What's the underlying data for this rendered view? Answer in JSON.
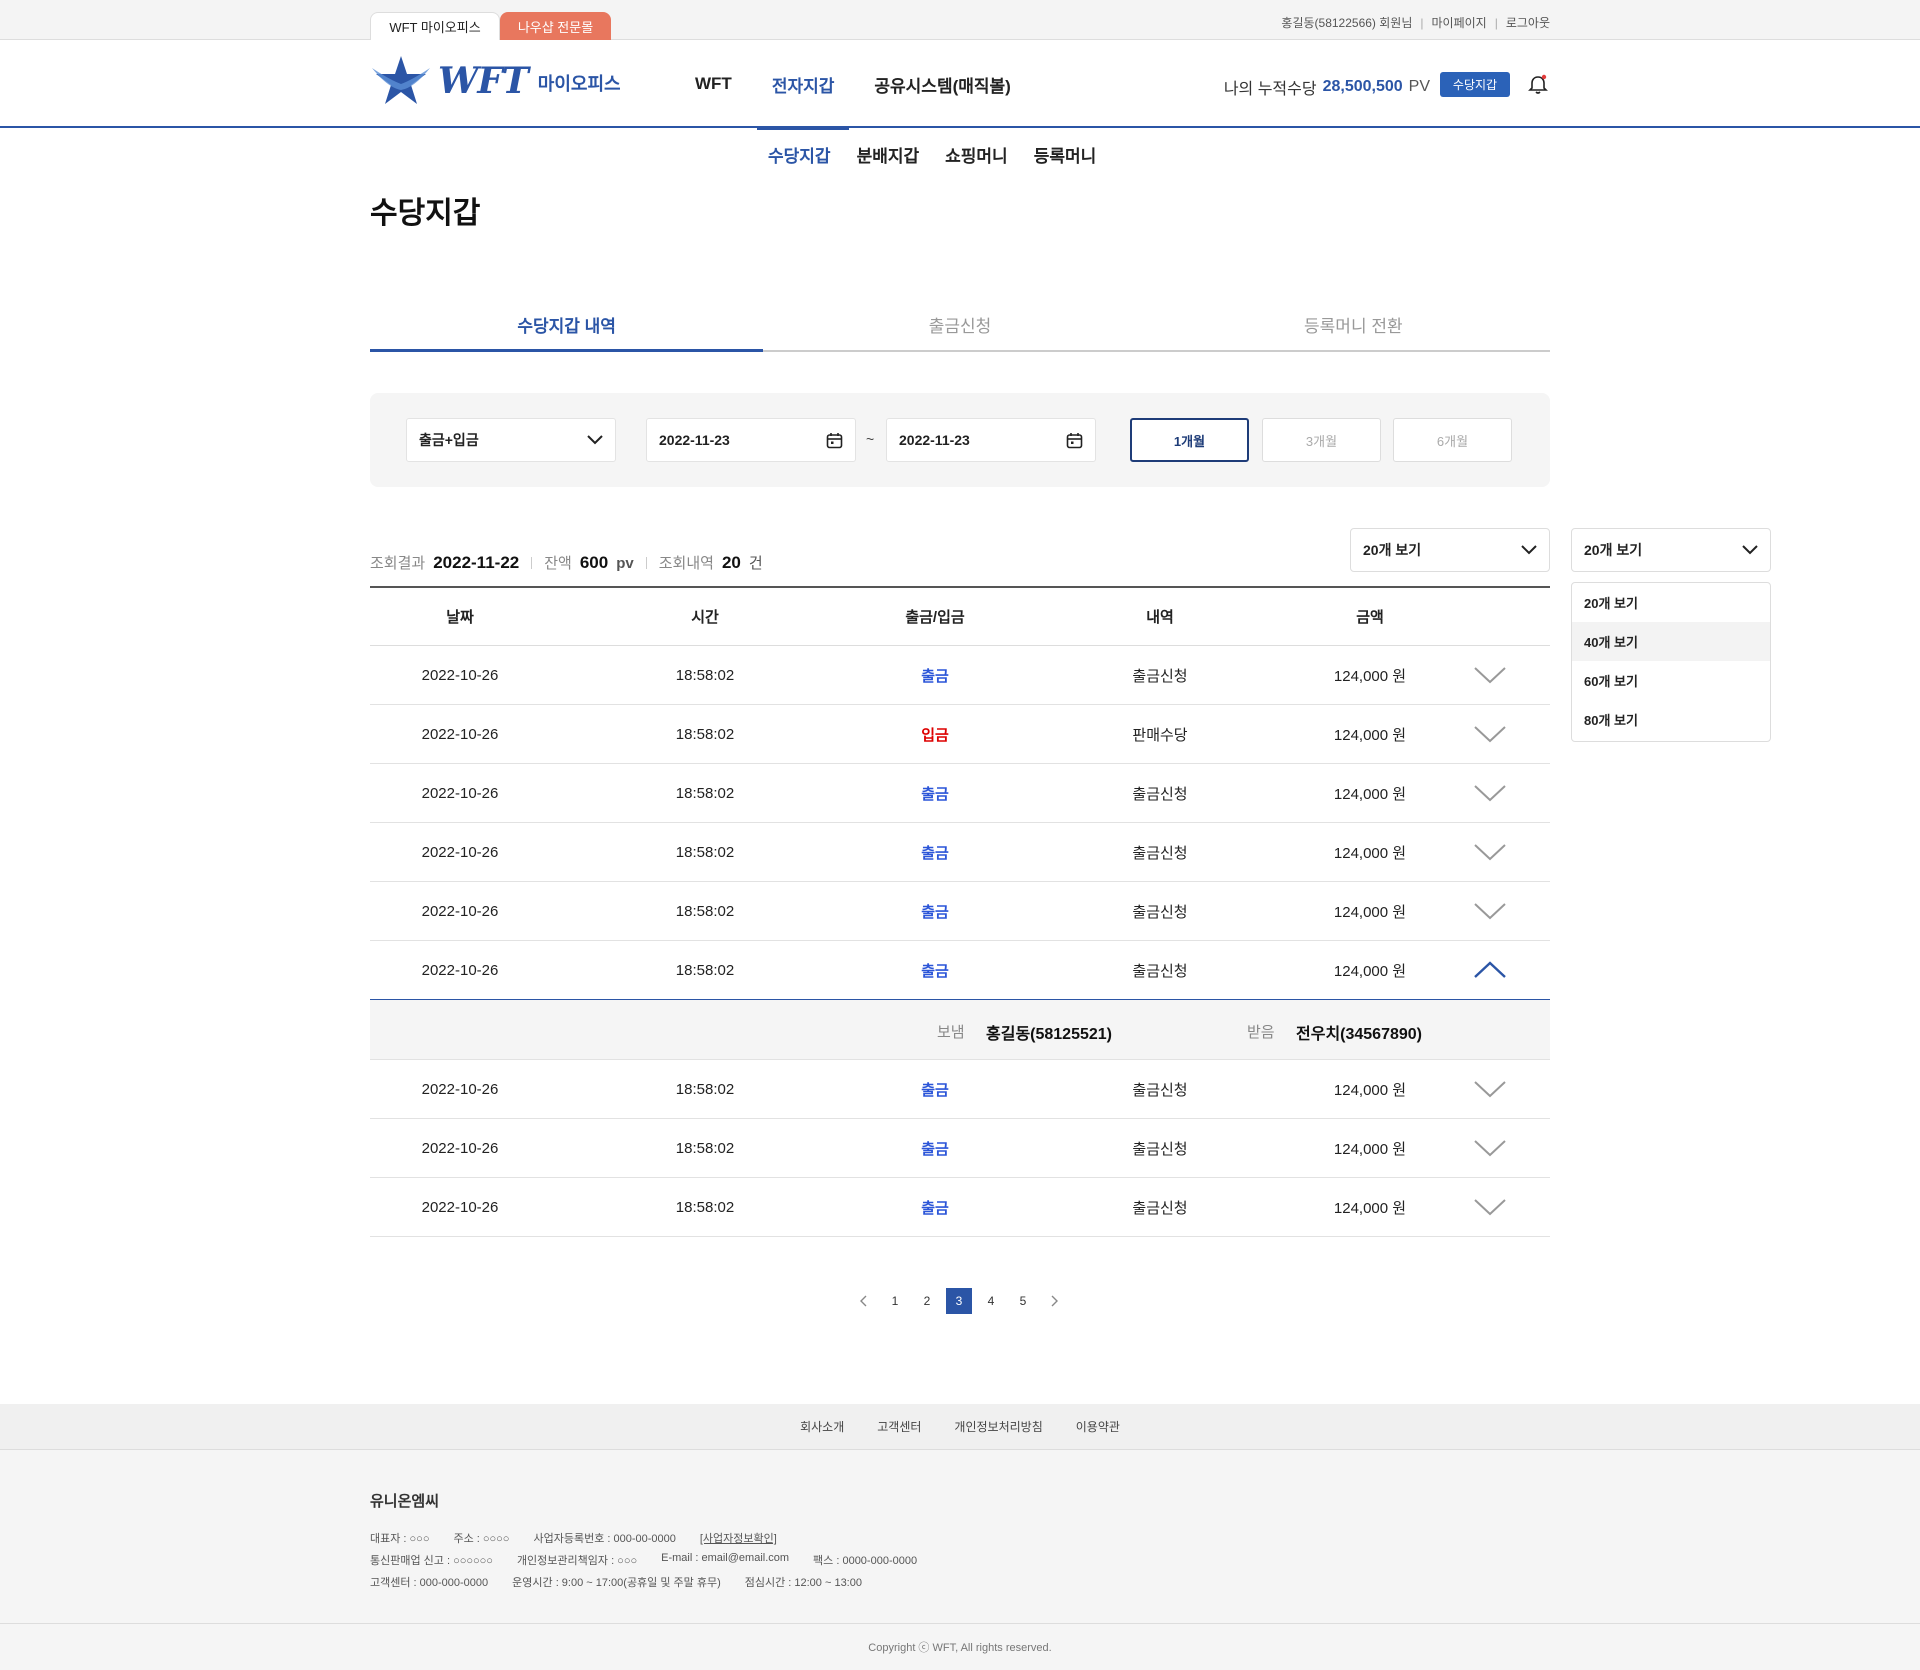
{
  "topbar": {
    "site_tabs": [
      "WFT 마이오피스",
      "나우샵 전문몰"
    ],
    "user": "홍길동(58122566) 회원님",
    "mypage": "마이페이지",
    "logout": "로그아웃"
  },
  "header": {
    "logo_text": "WFT",
    "logo_sub": "마이오피스",
    "gnb": [
      "WFT",
      "전자지갑",
      "공유시스템(매직볼)"
    ],
    "accum_label": "나의 누적수당",
    "accum_value": "28,500,500",
    "accum_unit": "PV",
    "wallet_button": "수당지갑"
  },
  "subnav": [
    "수당지갑",
    "분배지갑",
    "쇼핑머니",
    "등록머니"
  ],
  "page_title": "수당지갑",
  "tabs": [
    "수당지갑 내역",
    "출금신청",
    "등록머니 전환"
  ],
  "filter": {
    "type": "출금+입금",
    "date_from": "2022-11-23",
    "tilde": "~",
    "date_to": "2022-11-23",
    "periods": [
      "1개월",
      "3개월",
      "6개월"
    ]
  },
  "summary": {
    "result_label": "조회결과",
    "result_date": "2022-11-22",
    "balance_label": "잔액",
    "balance_value": "600",
    "balance_unit": "pv",
    "count_label": "조회내역",
    "count_value": "20",
    "count_unit": "건"
  },
  "view_select": {
    "value": "20개 보기",
    "options": [
      "20개 보기",
      "40개 보기",
      "60개 보기",
      "80개 보기"
    ]
  },
  "table": {
    "headers": [
      "날짜",
      "시간",
      "출금/입금",
      "내역",
      "금액"
    ],
    "rows": [
      [
        "2022-10-26",
        "18:58:02",
        "출금",
        "출금신청",
        "124,000 원"
      ],
      [
        "2022-10-26",
        "18:58:02",
        "입금",
        "판매수당",
        "124,000 원"
      ],
      [
        "2022-10-26",
        "18:58:02",
        "출금",
        "출금신청",
        "124,000 원"
      ],
      [
        "2022-10-26",
        "18:58:02",
        "출금",
        "출금신청",
        "124,000 원"
      ],
      [
        "2022-10-26",
        "18:58:02",
        "출금",
        "출금신청",
        "124,000 원"
      ],
      [
        "2022-10-26",
        "18:58:02",
        "출금",
        "출금신청",
        "124,000 원"
      ],
      [
        "2022-10-26",
        "18:58:02",
        "출금",
        "출금신청",
        "124,000 원"
      ],
      [
        "2022-10-26",
        "18:58:02",
        "출금",
        "출금신청",
        "124,000 원"
      ],
      [
        "2022-10-26",
        "18:58:02",
        "출금",
        "출금신청",
        "124,000 원"
      ]
    ],
    "detail": {
      "sender_label": "보냄",
      "sender": "홍길동(58125521)",
      "receiver_label": "받음",
      "receiver": "전우치(34567890)"
    }
  },
  "pager": {
    "pages": [
      "1",
      "2",
      "3",
      "4",
      "5"
    ],
    "current": "3"
  },
  "footer": {
    "nav": [
      "회사소개",
      "고객센터",
      "개인정보처리방침",
      "이용약관"
    ],
    "company": "유니온엠씨",
    "line1": [
      "대표자 : ○○○",
      "주소 : ○○○○",
      "사업자등록번호 : 000-00-0000",
      "[사업자정보확인]"
    ],
    "line2": [
      "통신판매업 신고 : ○○○○○○",
      "개인정보관리책임자 : ○○○",
      "E-mail : email@email.com",
      "팩스 : 0000-000-0000"
    ],
    "line3": [
      "고객센터 : 000-000-0000",
      "운영시간 : 9:00 ~ 17:00(공휴일 및 주말 휴무)",
      "점심시간 : 12:00 ~ 13:00"
    ],
    "copyright": "Copyright ⓒ WFT,  All rights reserved."
  },
  "colors": {
    "brand": "#2b55a6",
    "orange_tab": "#e8775e",
    "out": "#2b55d8",
    "in": "#dd0000"
  }
}
